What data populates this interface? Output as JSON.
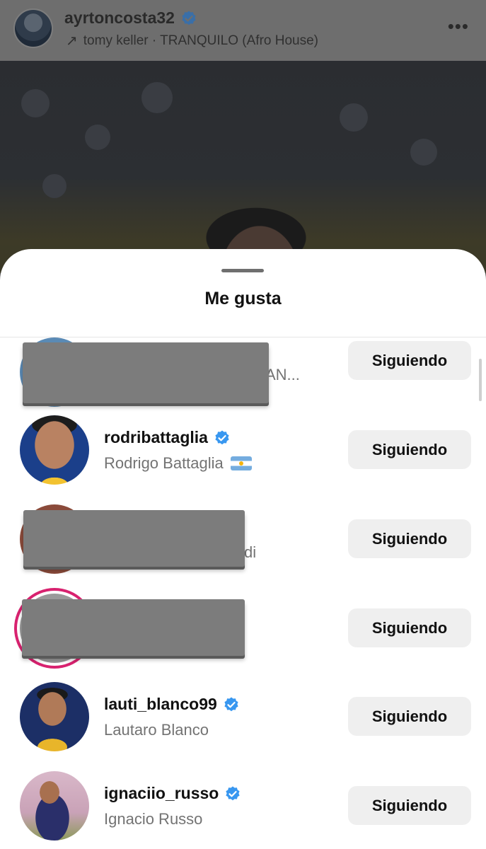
{
  "post": {
    "username": "ayrtoncosta32",
    "audio_line": "tomy keller · TRANQUILO (Afro House)",
    "audio_icon": "arrow-up-right-icon",
    "more_icon": "more-horizontal-icon",
    "more_glyph": "•••"
  },
  "sheet": {
    "title": "Me gusta"
  },
  "likes": [
    {
      "username": "",
      "fullname": "AN...",
      "verified": false,
      "button": "Siguiendo",
      "redacted": true
    },
    {
      "username": "rodribattaglia",
      "fullname": "Rodrigo Battaglia",
      "verified": true,
      "flag": "argentina-flag-icon",
      "button": "Siguiendo",
      "redacted": false
    },
    {
      "username": "",
      "fullname": "di",
      "verified": false,
      "button": "Siguiendo",
      "redacted": true
    },
    {
      "username": "",
      "fullname": "",
      "verified": false,
      "button": "Siguiendo",
      "redacted": true,
      "story_ring": true
    },
    {
      "username": "lauti_blanco99",
      "fullname": "Lautaro Blanco",
      "verified": true,
      "button": "Siguiendo",
      "redacted": false
    },
    {
      "username": "ignaciio_russo",
      "fullname": "Ignacio Russo",
      "verified": true,
      "button": "Siguiendo",
      "redacted": false
    }
  ],
  "colors": {
    "verified": "#3897f0",
    "button_bg": "#efefef",
    "secondary_text": "#737373",
    "story_ring": "#d8226f"
  }
}
